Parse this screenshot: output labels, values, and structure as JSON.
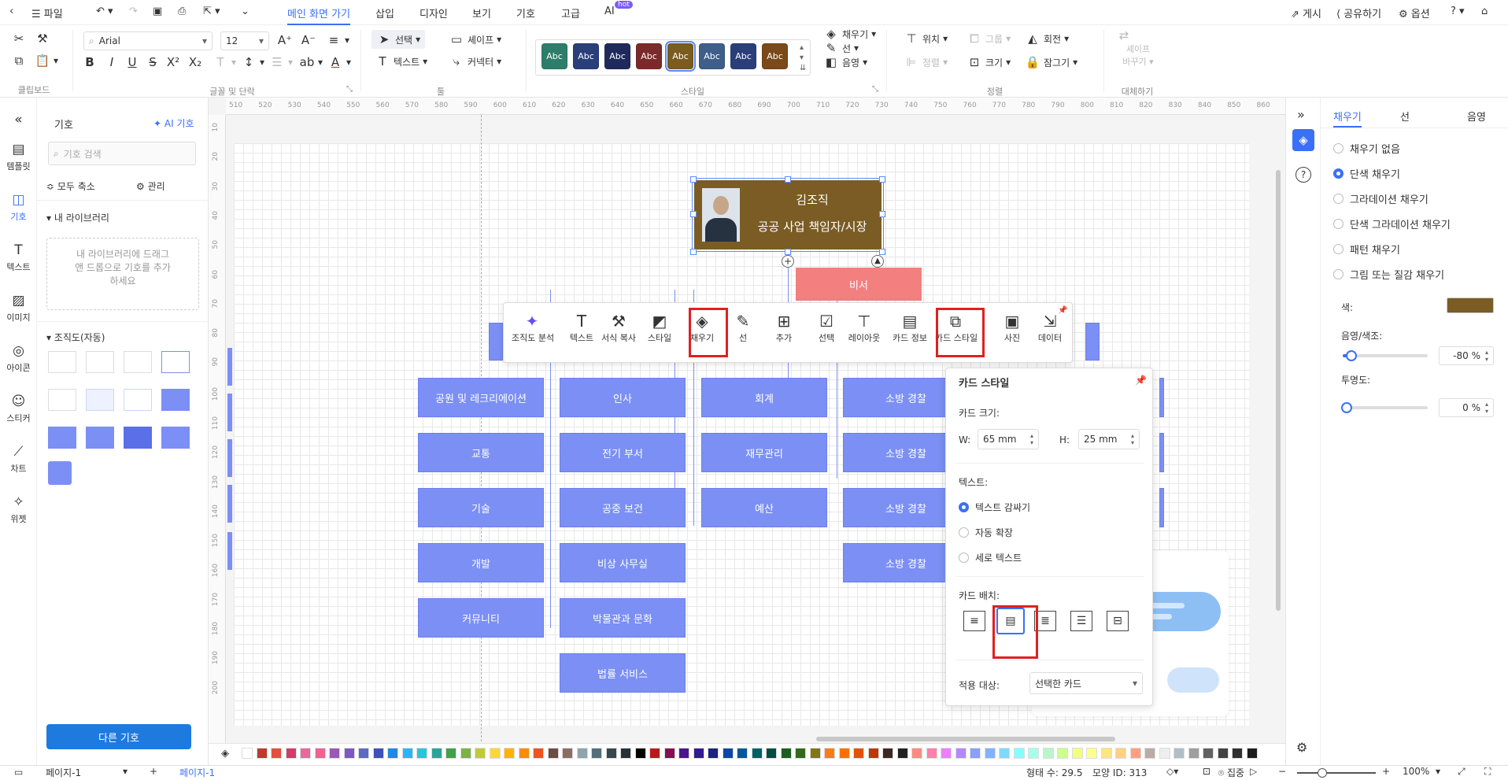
{
  "titlebar": {
    "file_label": "파일",
    "tabs": [
      {
        "label": "메인 화면 가기",
        "active": true
      },
      {
        "label": "삽입"
      },
      {
        "label": "디자인"
      },
      {
        "label": "보기"
      },
      {
        "label": "기호"
      },
      {
        "label": "고급"
      },
      {
        "label": "AI"
      }
    ],
    "ai_badge": "hot",
    "right": {
      "publish": "게시",
      "share": "공유하기",
      "options": "옵션"
    }
  },
  "ribbon": {
    "font_name": "Arial",
    "font_size": "12",
    "select_label": "선택",
    "shape_label": "셰이프",
    "text_label": "텍스트",
    "connector_label": "커넥터",
    "style_swatch_text": "Abc",
    "style_swatch_colors": [
      "#2e7d6b",
      "#2a3f7a",
      "#1f2a5c",
      "#7a2a2a",
      "#7a5c1f",
      "#3f5f8a",
      "#2a3f7a",
      "#7a4a1a"
    ],
    "fill_label": "채우기",
    "line_label": "선",
    "shadow_label": "음영",
    "position_label": "위치",
    "group_label": "그룹",
    "rotate_label": "회전",
    "align_label": "정렬",
    "size_label": "크기",
    "lock_label": "잠그기",
    "replace_shape_label1": "셰이프",
    "replace_shape_label2": "바꾸기",
    "groups": {
      "clipboard": "클립보드",
      "font": "글꼴 및 단락",
      "tools": "툴",
      "style": "스타일",
      "arrange": "정렬",
      "replace": "대체하기"
    }
  },
  "leftrail": [
    {
      "label": "템플릿",
      "icon": "template-icon"
    },
    {
      "label": "기호",
      "icon": "symbol-icon",
      "active": true
    },
    {
      "label": "텍스트",
      "icon": "text-icon"
    },
    {
      "label": "이미지",
      "icon": "image-icon"
    },
    {
      "label": "아이콘",
      "icon": "icon-icon"
    },
    {
      "label": "스티커",
      "icon": "sticker-icon"
    },
    {
      "label": "차트",
      "icon": "chart-icon"
    },
    {
      "label": "위젯",
      "icon": "widget-icon"
    }
  ],
  "leftpanel": {
    "title": "기호",
    "ai_symbol": "AI 기호",
    "search_placeholder": "기호 검색",
    "collapse_all": "모두 축소",
    "manage": "관리",
    "my_library": "내 라이브러리",
    "drop_hint": "내 라이브러리에 드래그 앤 드롭으로 기호를 추가하세요",
    "org_chart": "조직도(자동)",
    "more_symbols": "다른 기호"
  },
  "ruler": {
    "h_ticks": [
      "510",
      "520",
      "530",
      "540",
      "550",
      "560",
      "570",
      "580",
      "590",
      "600",
      "610",
      "620",
      "630",
      "640",
      "650",
      "660",
      "670",
      "680",
      "690",
      "700",
      "710",
      "720",
      "730",
      "740",
      "750",
      "760",
      "770",
      "780",
      "790",
      "800",
      "810",
      "820",
      "830",
      "840",
      "850",
      "860"
    ],
    "v_ticks": [
      "10",
      "20",
      "30",
      "40",
      "50",
      "60",
      "70",
      "80",
      "90",
      "100",
      "110",
      "120",
      "130",
      "140",
      "150",
      "160",
      "170",
      "180",
      "190",
      "200"
    ]
  },
  "org": {
    "root_name": "김조직",
    "root_title": "공공 사업 책임자/시장",
    "root_color": "#7a5c24",
    "secretary": "비서",
    "secretary_color": "#f47f7f",
    "node_color": "#7b8ff5",
    "col1": [
      "공원 및 레크리에이션",
      "교통",
      "기술",
      "개발",
      "커뮤니티"
    ],
    "col2": [
      "인사",
      "전기 부서",
      "공중 보건",
      "비상 사무실",
      "박물관과 문화",
      "법률 서비스"
    ],
    "col3": [
      "회계",
      "재무관리",
      "예산"
    ],
    "col4": [
      "소방 경찰",
      "소방 경찰",
      "소방 경찰",
      "소방 경찰"
    ]
  },
  "ctxbar": [
    {
      "label": "조직도 분석",
      "icon": "ai-sparkle-icon"
    },
    {
      "label": "텍스트",
      "icon": "text-icon"
    },
    {
      "label": "서식 복사",
      "icon": "format-painter-icon"
    },
    {
      "label": "스타일",
      "icon": "style-icon"
    },
    {
      "label": "채우기",
      "icon": "fill-bucket-icon"
    },
    {
      "label": "선",
      "icon": "line-pen-icon"
    },
    {
      "label": "추가",
      "icon": "add-node-icon"
    },
    {
      "label": "선택",
      "icon": "select-check-icon"
    },
    {
      "label": "레이아웃",
      "icon": "layout-icon"
    },
    {
      "label": "카드 정보",
      "icon": "card-info-icon"
    },
    {
      "label": "카드 스타일",
      "icon": "card-style-icon"
    },
    {
      "label": "사진",
      "icon": "photo-icon"
    },
    {
      "label": "데이터",
      "icon": "data-icon"
    }
  ],
  "cardpanel": {
    "title": "카드 스타일",
    "size_label": "카드 크기:",
    "w_label": "W:",
    "w_value": "65 mm",
    "h_label": "H:",
    "h_value": "25 mm",
    "text_label": "텍스트:",
    "text_options": [
      {
        "label": "텍스트 감싸기",
        "selected": true
      },
      {
        "label": "자동 확장"
      },
      {
        "label": "세로 텍스트"
      }
    ],
    "layout_label": "카드 배치:",
    "apply_label": "적용 대상:",
    "apply_value": "선택한 카드"
  },
  "rightpanel": {
    "tabs": [
      {
        "label": "채우기",
        "active": true
      },
      {
        "label": "선"
      },
      {
        "label": "음영"
      }
    ],
    "fill_options": [
      {
        "label": "채우기 없음"
      },
      {
        "label": "단색 채우기",
        "selected": true
      },
      {
        "label": "그라데이션 채우기"
      },
      {
        "label": "단색 그라데이션 채우기"
      },
      {
        "label": "패턴 채우기"
      },
      {
        "label": "그림 또는 질감 채우기"
      }
    ],
    "color_label": "색:",
    "color_value": "#7a5c24",
    "shade_label": "음영/색조:",
    "shade_value": "-80 %",
    "shade_level": 0.1,
    "opacity_label": "투명도:",
    "opacity_value": "0 %",
    "opacity_level": 0.0
  },
  "palette_colors": [
    "#ffffff",
    "#c0392b",
    "#e74c3c",
    "#d63a6a",
    "#e86a9a",
    "#f06292",
    "#9b59b6",
    "#7e57c2",
    "#5c6bc0",
    "#3f51b5",
    "#1e88e5",
    "#29b6f6",
    "#26c6da",
    "#26a69a",
    "#43a047",
    "#7cb342",
    "#c0ca33",
    "#fdd835",
    "#ffb300",
    "#fb8c00",
    "#f4511e",
    "#6d4c41",
    "#8d6e63",
    "#90a4ae",
    "#546e7a",
    "#37474f",
    "#263238",
    "#000000",
    "#b71c1c",
    "#880e4f",
    "#4a148c",
    "#311b92",
    "#1a237e",
    "#0d47a1",
    "#01579b",
    "#006064",
    "#004d40",
    "#1b5e20",
    "#33691e",
    "#827717",
    "#f57f17",
    "#ff6f00",
    "#e65100",
    "#bf360c",
    "#3e2723",
    "#212121",
    "#ff8a80",
    "#ff80ab",
    "#ea80fc",
    "#b388ff",
    "#8c9eff",
    "#82b1ff",
    "#80d8ff",
    "#84ffff",
    "#a7ffeb",
    "#b9f6ca",
    "#ccff90",
    "#f4ff81",
    "#ffff8d",
    "#ffe57f",
    "#ffd180",
    "#ff9e80",
    "#bcaaa4",
    "#eeeeee",
    "#b0bec5",
    "#9e9e9e",
    "#616161",
    "#424242",
    "#303030",
    "#1c1c1c"
  ],
  "statusbar": {
    "page_select": "페이지-1",
    "page_tab": "페이지-1",
    "shape_count": "형태 수: 29.5",
    "shape_id": "모양 ID: 313",
    "focus": "집중",
    "zoom": "100%"
  }
}
